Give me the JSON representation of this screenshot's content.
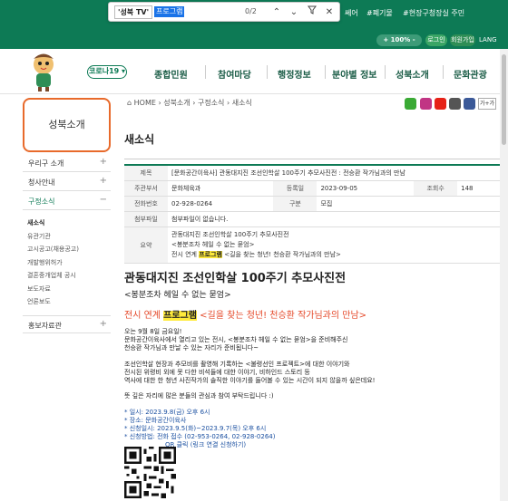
{
  "find_bar": {
    "chip": "'성북 TV'",
    "query": "프로그램",
    "count": "0/2"
  },
  "top_links": {
    "link1": "쎄어",
    "link2": "#폐기물",
    "link3": "#현장구청장실 주민"
  },
  "util": {
    "zoom": "+ 100% -",
    "login": "로그인",
    "join": "회원가입",
    "lang": "LANG"
  },
  "nav": {
    "corona": "코로나19 ▾",
    "items": [
      "종합민원",
      "참여마당",
      "행정정보",
      "분야별 정보",
      "성북소개",
      "문화관광"
    ]
  },
  "sidebar": {
    "title": "성북소개",
    "items": [
      "우리구 소개",
      "청사안내",
      "구정소식"
    ],
    "sub_items": [
      "새소식",
      "유관기관",
      "고시공고(채용공고)",
      "개발행위허가",
      "결혼중개업체 공시",
      "보도자료",
      "언론보도"
    ],
    "last": "홍보자료관"
  },
  "breadcrumb": {
    "home": "HOME",
    "c1": "성북소개",
    "c2": "구정소식",
    "c3": "새소식"
  },
  "print_size": "가+가",
  "page_title": "새소식",
  "info": {
    "subject_label": "제목",
    "subject": "[문화공간이육사] 관동대지진 조선인학살 100주기 추모사진전 : 전승환 작가님과의 만남",
    "dept_label": "주관부서",
    "dept": "문화체육과",
    "date_label": "등록일",
    "date": "2023-09-05",
    "views_label": "조회수",
    "views": "148",
    "phone_label": "전화번호",
    "phone": "02-928-0264",
    "cat_label": "구분",
    "cat": "모집",
    "attach_label": "첨부파일",
    "attach": "첨부파일이 없습니다.",
    "summary_label": "요약",
    "summary1": "관동대지진 조선인학살 100주기 추모사진전",
    "summary2": "<봉분조차 헤일 수 없는 묻엄>",
    "summary3_a": "전시 연계 ",
    "summary3_hl": "프로그램",
    "summary3_b": " <길을 찾는 청년! 천승환 작가님과의 만남>"
  },
  "content": {
    "title": "관동대지진 조선인학살 100주기 추모사진전",
    "subtitle": "<봉분조차 헤일 수 없는 묻엄>",
    "sub2_a": "전시 연계 ",
    "sub2_hl": "프로그램",
    "sub2_b": " <길을 찾는 청년! 천승환 작가님과의 만남>",
    "p1": [
      "오는 9월 8일 금요일!",
      "문화공간이육사에서 열리고 있는 전시, <봉분조차 헤일 수 없는 묻엄>을 준비해주신",
      "천승환 작가님과 만날 수 있는 자리가 준비됩니다~"
    ],
    "p2": [
      "조선인학살 현장과 추모비를 촬영해 기록하는 <불령선인 프로젝트>에 대한 이야기와",
      "전시된 위령비 외에 못 다한 비석들에 대한 이야기, 비하인드 스토리 등",
      "역사에 대한 한 청년 사진작가의 솔직한 이야기를 들어볼 수 있는 시간이 되지 않을까 싶은데요!"
    ],
    "p3": "뜻 깊은 자리에 많은 분들의 관심과 참여 부탁드립니다 :)",
    "details": [
      "* 일시: 2023.9.8(금) 오후 6시",
      "* 장소: 문화공간이육사",
      "* 신청일시: 2023.9.5(화)~2023.9.7(목) 오후 6시",
      "* 신청방법: 전화 접수 (02-953-0264, 02-928-0264)",
      "QR 클릭 (링크 연결 신청하기)"
    ]
  },
  "colors": {
    "brand": "#0d7a55",
    "accent": "#e86a2b",
    "link": "#1a4fa0",
    "highlight": "#ffeb3b"
  }
}
